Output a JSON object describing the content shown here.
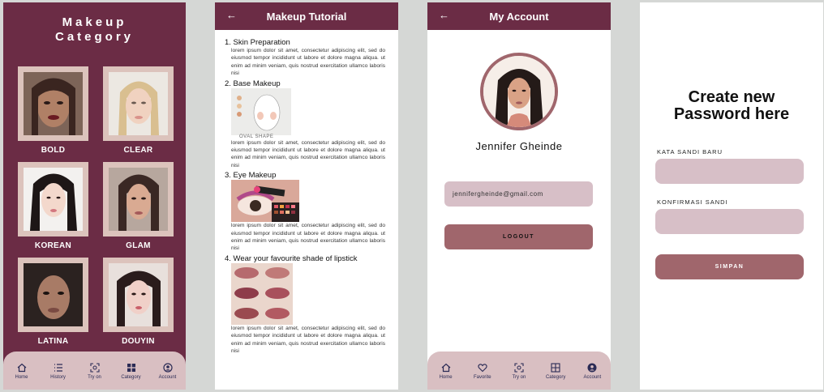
{
  "category_screen": {
    "title_line1": "Makeup",
    "title_line2": "Category",
    "categories": [
      {
        "label": "BOLD"
      },
      {
        "label": "CLEAR"
      },
      {
        "label": "KOREAN"
      },
      {
        "label": "GLAM"
      },
      {
        "label": "LATINA"
      },
      {
        "label": "DOUYIN"
      }
    ],
    "nav": [
      "Home",
      "History",
      "Try on",
      "Category",
      "Account"
    ]
  },
  "tutorial_screen": {
    "title": "Makeup Tutorial",
    "steps": [
      {
        "title": "1. Skin Preparation",
        "body": "lorem ipsum dolor sit amet, consectetur adipiscing elit, sed do eiusmod tempor incididunt ut labore et dolore magna aliqua. ut enim ad minim veniam, quis nostrud exercitation ullamco laboris nisi"
      },
      {
        "title": "2. Base Makeup",
        "image_caption": "OVAL SHAPE",
        "body": "lorem ipsum dolor sit amet, consectetur adipiscing elit, sed do eiusmod tempor incididunt ut labore et dolore magna aliqua. ut enim ad minim veniam, quis nostrud exercitation ullamco laboris nisi"
      },
      {
        "title": "3. Eye Makeup",
        "body": "lorem ipsum dolor sit amet, consectetur adipiscing elit, sed do eiusmod tempor incididunt ut labore et dolore magna aliqua. ut enim ad minim veniam, quis nostrud exercitation ullamco laboris nisi"
      },
      {
        "title": "4. Wear your favourite shade of lipstick",
        "body": "lorem ipsum dolor sit amet, consectetur adipiscing elit, sed do eiusmod tempor incididunt ut labore et dolore magna aliqua. ut enim ad minim veniam, quis nostrud exercitation ullamco laboris nisi"
      }
    ]
  },
  "account_screen": {
    "title": "My Account",
    "name": "Jennifer Gheinde",
    "email": "jennifergheinde@gmail.com",
    "logout_label": "LOGOUT",
    "nav": [
      "Home",
      "Favorite",
      "Try on",
      "Category",
      "Account"
    ]
  },
  "password_screen": {
    "title_line1": "Create new",
    "title_line2": "Password here",
    "new_password_label": "KATA SANDI BARU",
    "confirm_password_label": "KONFIRMASI SANDI",
    "submit_label": "SIMPAN"
  },
  "colors": {
    "primary": "#6b2c45",
    "accent": "#a0666c",
    "field": "#d7bfc7",
    "nav_bg": "#d9bfc2"
  }
}
